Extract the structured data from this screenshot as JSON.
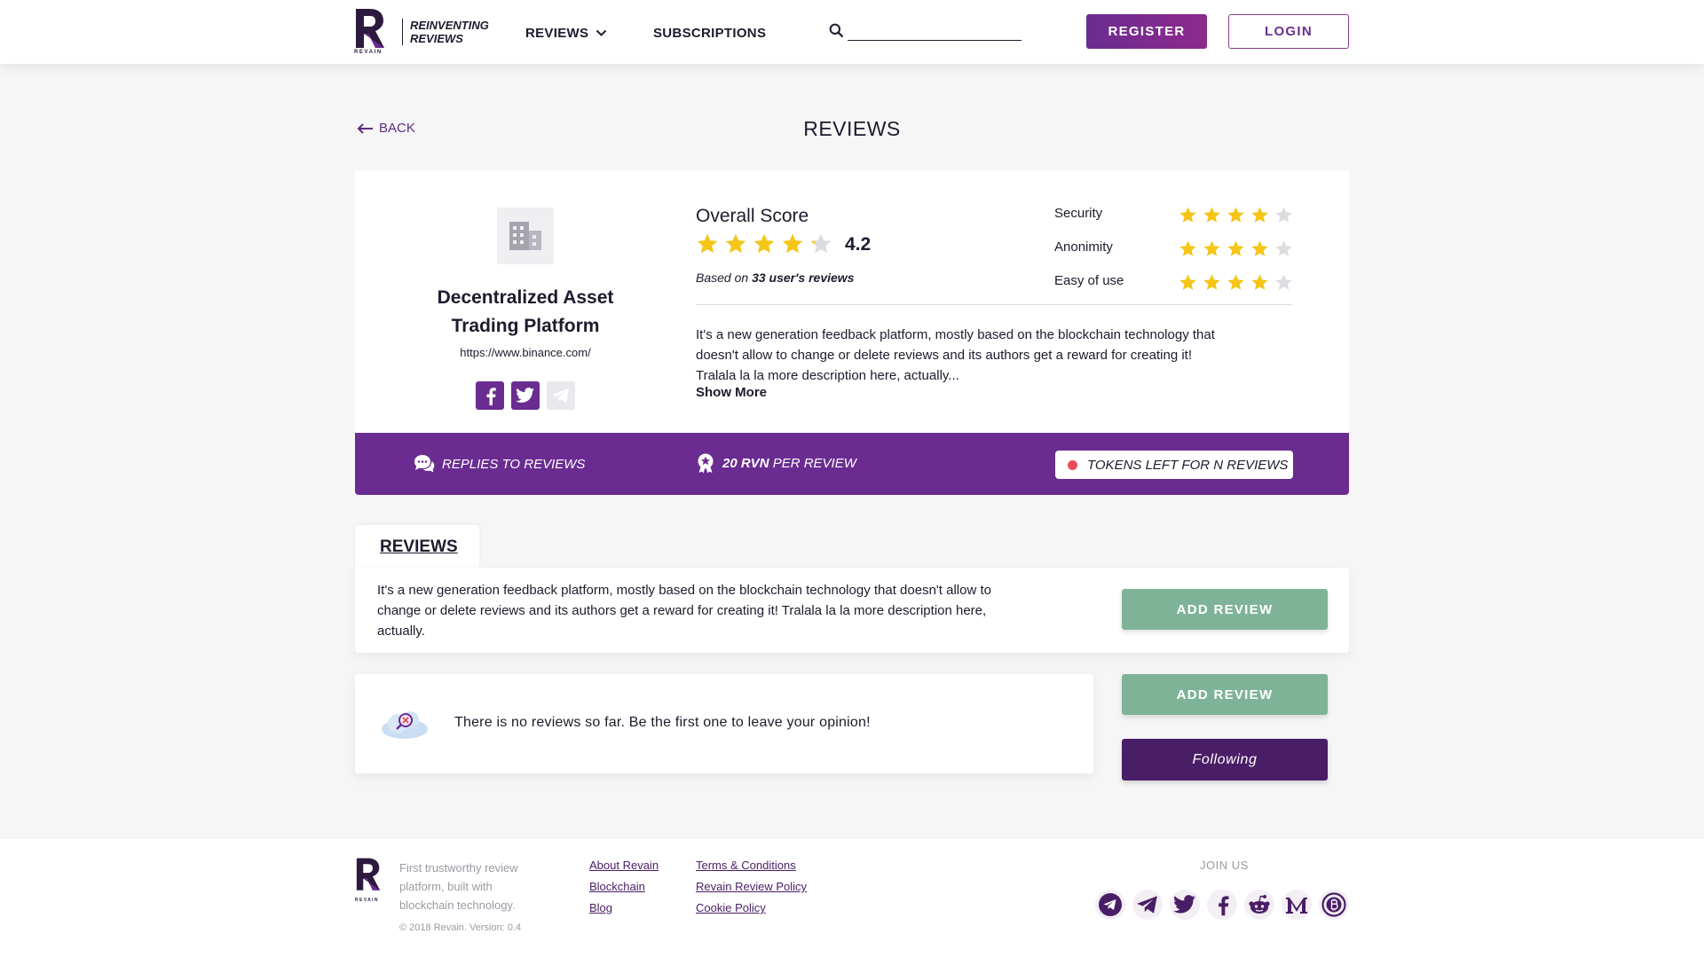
{
  "header": {
    "tagline_line1": "REINVENTING",
    "tagline_line2": "REVIEWS",
    "logo_small_text": "REVAIN",
    "nav": {
      "reviews": "REVIEWS",
      "subscriptions": "SUBSCRIPTIONS"
    },
    "search_placeholder": "",
    "register_label": "REGISTER",
    "login_label": "LOGIN"
  },
  "page": {
    "back_label": "BACK",
    "title": "REVIEWS"
  },
  "company": {
    "name_line1": "Decentralized Asset",
    "name_line2": "Trading Platform",
    "url": "https://www.binance.com/",
    "overall_title": "Overall Score",
    "overall_value": "4.2",
    "overall_stars": 4.2,
    "based_on_prefix": "Based on ",
    "based_on_count": "33 user's reviews",
    "criteria": [
      {
        "label": "Security",
        "stars": 4
      },
      {
        "label": "Anonimity",
        "stars": 4
      },
      {
        "label": "Easy of use",
        "stars": 4
      }
    ],
    "description_1": "It's a new generation feedback platform, mostly based on the blockchain technology that",
    "description_2": "doesn't allow to change or delete reviews and its authors get a reward for creating it!",
    "description_3": "Tralala la la more description here, actually...",
    "show_more": "Show More"
  },
  "band": {
    "replies": "REPLIES TO REVIEWS",
    "rvn_amount": "20 RVN",
    "rvn_suffix": " PER REVIEW",
    "tokens": "TOKENS LEFT FOR N REVIEWS"
  },
  "reviews": {
    "tab_label": "REVIEWS",
    "text_1": "It's a new generation feedback platform, mostly based on the blockchain technology that doesn't allow to",
    "text_2": "change or delete reviews and its authors get a reward for creating it! Tralala la la more description here,",
    "text_3": "actually.",
    "add_review_label": "ADD REVIEW",
    "empty_text": "There is no reviews so far. Be the first one to leave your opinion!",
    "following_label": "Following"
  },
  "footer": {
    "tagline_1": "First trustworthy review",
    "tagline_2": "platform, built with",
    "tagline_3": "blockchain technology.",
    "copyright": "© 2018 Revain. Version: 0.4",
    "links_col1": [
      "About Revain",
      "Blockchain",
      "Blog"
    ],
    "links_col2": [
      "Terms & Conditions",
      "Revain Review Policy",
      "Cookie Policy"
    ],
    "join_us": "JOIN US"
  },
  "colors": {
    "brand_purple": "#6a2c91",
    "dark_purple": "#4a1e66",
    "green_button": "#7fb397",
    "star_gold": "#f5c518",
    "star_empty": "#dcdce0",
    "alert_red": "#ec4a5a"
  },
  "icons": {
    "social_company": [
      "facebook-icon",
      "twitter-icon",
      "telegram-icon"
    ],
    "social_footer": [
      "telegram-circle-icon",
      "telegram-icon",
      "twitter-icon",
      "facebook-icon",
      "reddit-icon",
      "medium-icon",
      "bitcoin-icon"
    ]
  }
}
